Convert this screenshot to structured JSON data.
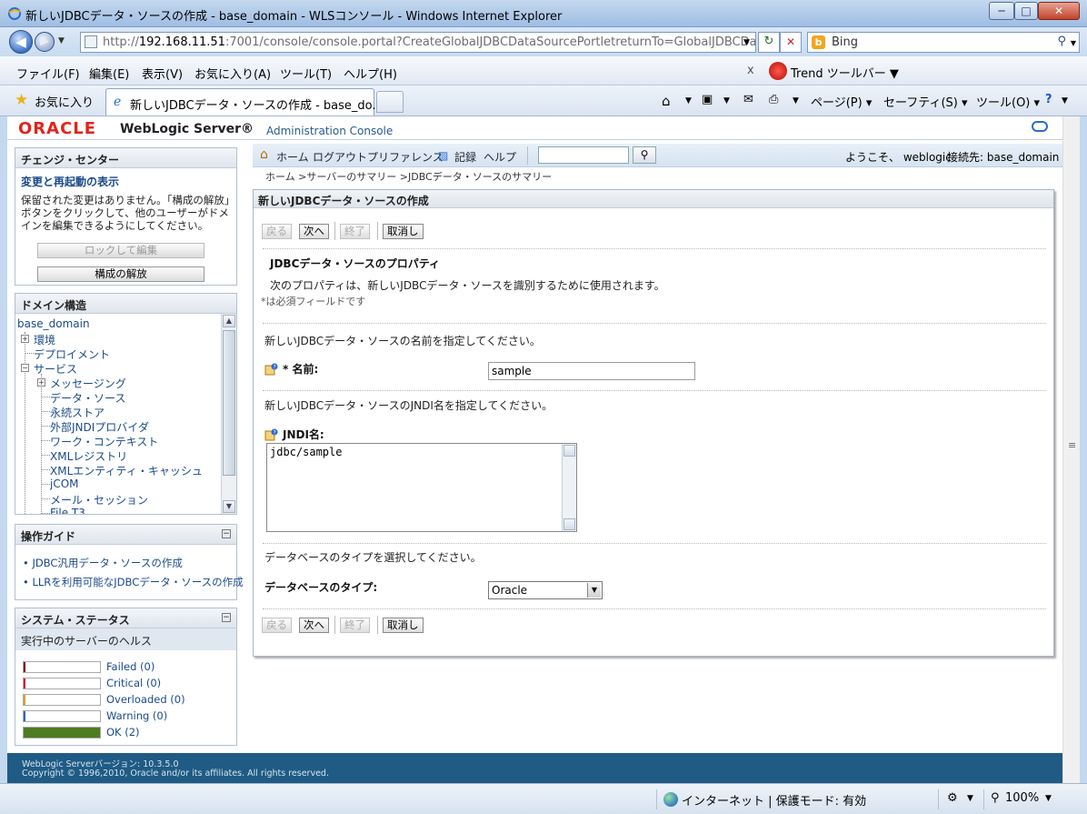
{
  "window": {
    "title": "新しいJDBCデータ・ソースの作成 - base_domain - WLSコンソール - Windows Internet Explorer",
    "min": "─",
    "max": "□",
    "close": "✕"
  },
  "address": {
    "url_prefix": "http://",
    "url_host": "192.168.11.51",
    "url_rest": ":7001/console/console.portal?CreateGlobalJDBCDataSourcePortletreturnTo=GlobalJDBCDataSource",
    "search_engine": "Bing"
  },
  "menu": [
    "ファイル(F)",
    "編集(E)",
    "表示(V)",
    "お気に入り(A)",
    "ツール(T)",
    "ヘルプ(H)"
  ],
  "trend_toolbar": "Trend ツールバー ▼",
  "favorites": {
    "label": "お気に入り",
    "tab_title": "新しいJDBCデータ・ソースの作成 - base_do...",
    "commands": [
      "ページ(P) ▾",
      "セーフティ(S) ▾",
      "ツール(O) ▾"
    ]
  },
  "console": {
    "brand": "ORACLE",
    "product": "WebLogic Server®",
    "admin": "Administration Console"
  },
  "change_center": {
    "title": "チェンジ・センター",
    "link": "変更と再起動の表示",
    "message": "保留された変更はありません。「構成の解放」ボタンをクリックして、他のユーザーがドメインを編集できるようにしてください。",
    "lock_button": "ロックして編集",
    "release_button": "構成の解放"
  },
  "domain_tree": {
    "title": "ドメイン構造",
    "root": "base_domain",
    "nodes": {
      "env": "環境",
      "deploy": "デプロイメント",
      "services": "サービス",
      "messaging": "メッセージング",
      "datasource": "データ・ソース",
      "persistent": "永続ストア",
      "jndi": "外部JNDIプロバイダ",
      "workctx": "ワーク・コンテキスト",
      "xmlreg": "XMLレジストリ",
      "xmlcache": "XMLエンティティ・キャッシュ",
      "jcom": "jCOM",
      "mail": "メール・セッション",
      "filet3": "File T3"
    }
  },
  "howto": {
    "title": "操作ガイド",
    "items": [
      "JDBC汎用データ・ソースの作成",
      "LLRを利用可能なJDBCデータ・ソースの作成"
    ]
  },
  "system_status": {
    "title": "システム・ステータス",
    "subtitle": "実行中のサーバーのヘルス",
    "rows": [
      {
        "label": "Failed (0)",
        "color": "#7a0000",
        "fill": 0
      },
      {
        "label": "Critical (0)",
        "color": "#d22020",
        "fill": 0
      },
      {
        "label": "Overloaded (0)",
        "color": "#e0a020",
        "fill": 0
      },
      {
        "label": "Warning (0)",
        "color": "#2a6ab0",
        "fill": 0
      },
      {
        "label": "OK (2)",
        "color": "#4f7b22",
        "fill": 1
      }
    ]
  },
  "toolbar": {
    "home": "ホーム",
    "logout": "ログアウト",
    "prefs": "プリファレンス",
    "record": "記録",
    "help": "ヘルプ",
    "welcome": "ようこそ、 weblogic",
    "connected": "接続先: base_domain"
  },
  "breadcrumb": "ホーム >サーバーのサマリー >JDBCデータ・ソースのサマリー",
  "form": {
    "panel_title": "新しいJDBCデータ・ソースの作成",
    "btn_back": "戻る",
    "btn_next": "次へ",
    "btn_finish": "終了",
    "btn_cancel": "取消し",
    "section_title": "JDBCデータ・ソースのプロパティ",
    "section_desc": "次のプロパティは、新しいJDBCデータ・ソースを識別するために使用されます。",
    "required_note": "*は必須フィールドです",
    "name_prompt": "新しいJDBCデータ・ソースの名前を指定してください。",
    "name_label": "* 名前:",
    "name_value": "sample",
    "jndi_prompt": "新しいJDBCデータ・ソースのJNDI名を指定してください。",
    "jndi_label": "JNDI名:",
    "jndi_value": "jdbc/sample",
    "db_prompt": "データベースのタイプを選択してください。",
    "db_label": "データベースのタイプ:",
    "db_value": "Oracle"
  },
  "footer": {
    "line1": "WebLogic Serverバージョン: 10.3.5.0",
    "line2": "Copyright © 1996,2010, Oracle and/or its affiliates. All rights reserved."
  },
  "statusbar": {
    "zone": "インターネット | 保護モード: 有効",
    "zoom": "100%"
  }
}
